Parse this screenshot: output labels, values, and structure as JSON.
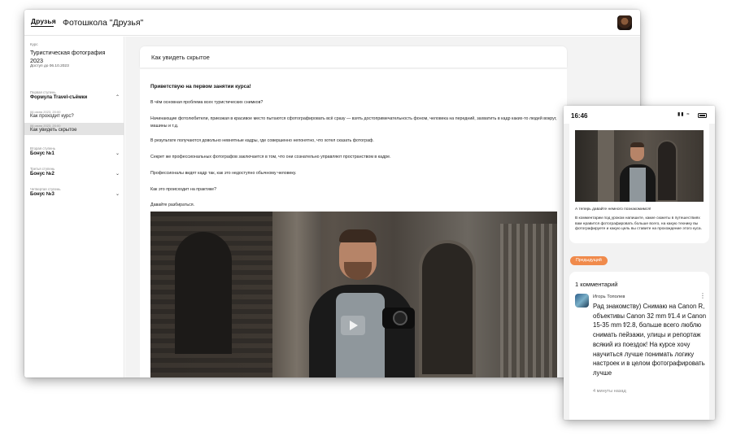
{
  "desktop": {
    "logo": "Друзья",
    "school_title": "Фотошкола \"Друзья\"",
    "sidebar": {
      "course_caption": "Курс",
      "course_title": "Туристическая фотография 2023",
      "access_until": "Доступ до 06.10.2023",
      "stages": [
        {
          "caption": "Первая ступень",
          "name": "Формула Travel-съёмки",
          "expanded": true
        },
        {
          "caption": "Вторая ступень",
          "name": "Бонус №1",
          "expanded": false
        },
        {
          "caption": "Третья ступень",
          "name": "Бонус №2",
          "expanded": false
        },
        {
          "caption": "Четвертая ступень",
          "name": "Бонус №3",
          "expanded": false
        }
      ],
      "lessons": [
        {
          "date": "06 июня 2023, 20:00",
          "name": "Как проходит курс?",
          "active": false
        },
        {
          "date": "06 июня 2023, 20:00",
          "name": "Как увидеть скрытое",
          "active": true
        }
      ]
    },
    "lesson": {
      "title": "Как увидеть скрытое",
      "greeting": "Приветствую на первом занятии курса!",
      "paragraphs": [
        "В чём основная проблема всех туристических снимков?",
        "Начинающие фотолюбители, приезжая в красивое место пытаются сфотографировать всё сразу — взять достопримечательность фоном, человека на передний, захватить в кадр каких-то людей вокруг, машины и т.д.",
        "В результате получаются довольно невнятные кадры, где совершенно непонятно, что хотел сказать фотограф.",
        "Секрет же профессиональных фотографов заключается в том, что они сознательно управляют пространством в кадре.",
        "Профессионалы видят кадр так, как это недоступно обычному человеку.",
        "Как это происходит на практике?",
        "Давайте разбираться."
      ]
    }
  },
  "phone": {
    "time": "16:46",
    "intro_lines": [
      "А теперь давайте немного познакомимся!",
      "В комментарии под уроком напишите, какие сюжеты в путешествиях вам нравится фотографировать больше всего, на какую технику вы фотографируете и какую цель вы ставите на прохождение этого куса."
    ],
    "prev_button": "Предыдущий",
    "comments": {
      "count_label": "1 комментарий",
      "items": [
        {
          "author": "Игорь Тополев",
          "text": "Рад знакомству) Снимаю на Canon R, объективы Canon 32 mm f/1.4 и Canon 15-35 mm f/2.8, больше всего люблю снимать пейзажи, улицы и репортаж всякий из поездок! На курсе хочу научиться лучше понимать логику настроек и в целом фотографировать лучше",
          "time": "4 минуты назад"
        }
      ]
    }
  },
  "colors": {
    "accent_orange": "#f08a4b",
    "active_lesson_bg": "#e3e3e3",
    "page_bg": "#f3f3f3"
  },
  "icons": [
    "chevron-up-icon",
    "chevron-down-icon",
    "play-icon",
    "more-vertical-icon",
    "location-arrow-icon",
    "signal-icon",
    "wifi-icon",
    "battery-icon"
  ]
}
